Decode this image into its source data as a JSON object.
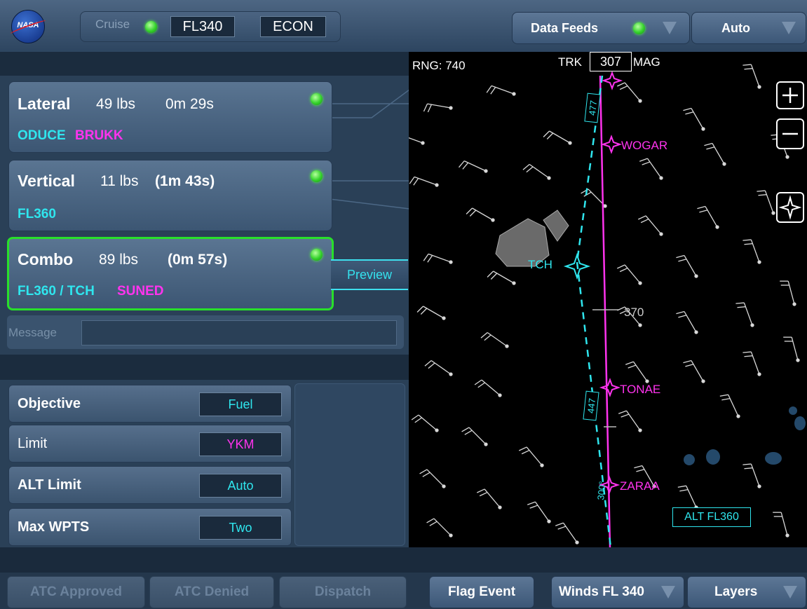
{
  "header": {
    "logo_text": "NASA",
    "phase": "Cruise",
    "flight_level": "FL340",
    "mode": "ECON",
    "data_feeds_label": "Data Feeds",
    "auto_label": "Auto"
  },
  "options": {
    "lateral": {
      "title": "Lateral",
      "fuel": "49 lbs",
      "time": "0m 29s",
      "route_a": "ODUCE",
      "route_b": "BRUKK"
    },
    "vertical": {
      "title": "Vertical",
      "fuel": "11 lbs",
      "time": "(1m 43s)",
      "route_a": "FL360"
    },
    "combo": {
      "title": "Combo",
      "fuel": "89 lbs",
      "time": "(0m 57s)",
      "route_a": "FL360 / TCH",
      "route_b": "SUNED"
    },
    "preview_label": "Preview"
  },
  "message": {
    "placeholder": "Message"
  },
  "settings": [
    {
      "label": "Objective",
      "value": "Fuel"
    },
    {
      "label": "Limit",
      "value": "YKM"
    },
    {
      "label": "ALT Limit",
      "value": "Auto"
    },
    {
      "label": "Max WPTS",
      "value": "Two"
    }
  ],
  "map": {
    "range": "RNG: 740",
    "trk_label": "TRK",
    "track": "307",
    "mag_label": "MAG",
    "waypoints": [
      "WOGAR",
      "TCH",
      "TONAE",
      "ZARAA"
    ],
    "altitude_mark": "370",
    "dist_labels": [
      "477",
      "447",
      "300°"
    ],
    "alt_box": "ALT FL360"
  },
  "bottom": {
    "atc_approved": "ATC Approved",
    "atc_denied": "ATC Denied",
    "dispatch": "Dispatch",
    "flag_event": "Flag Event",
    "winds": "Winds FL 340",
    "layers": "Layers"
  }
}
